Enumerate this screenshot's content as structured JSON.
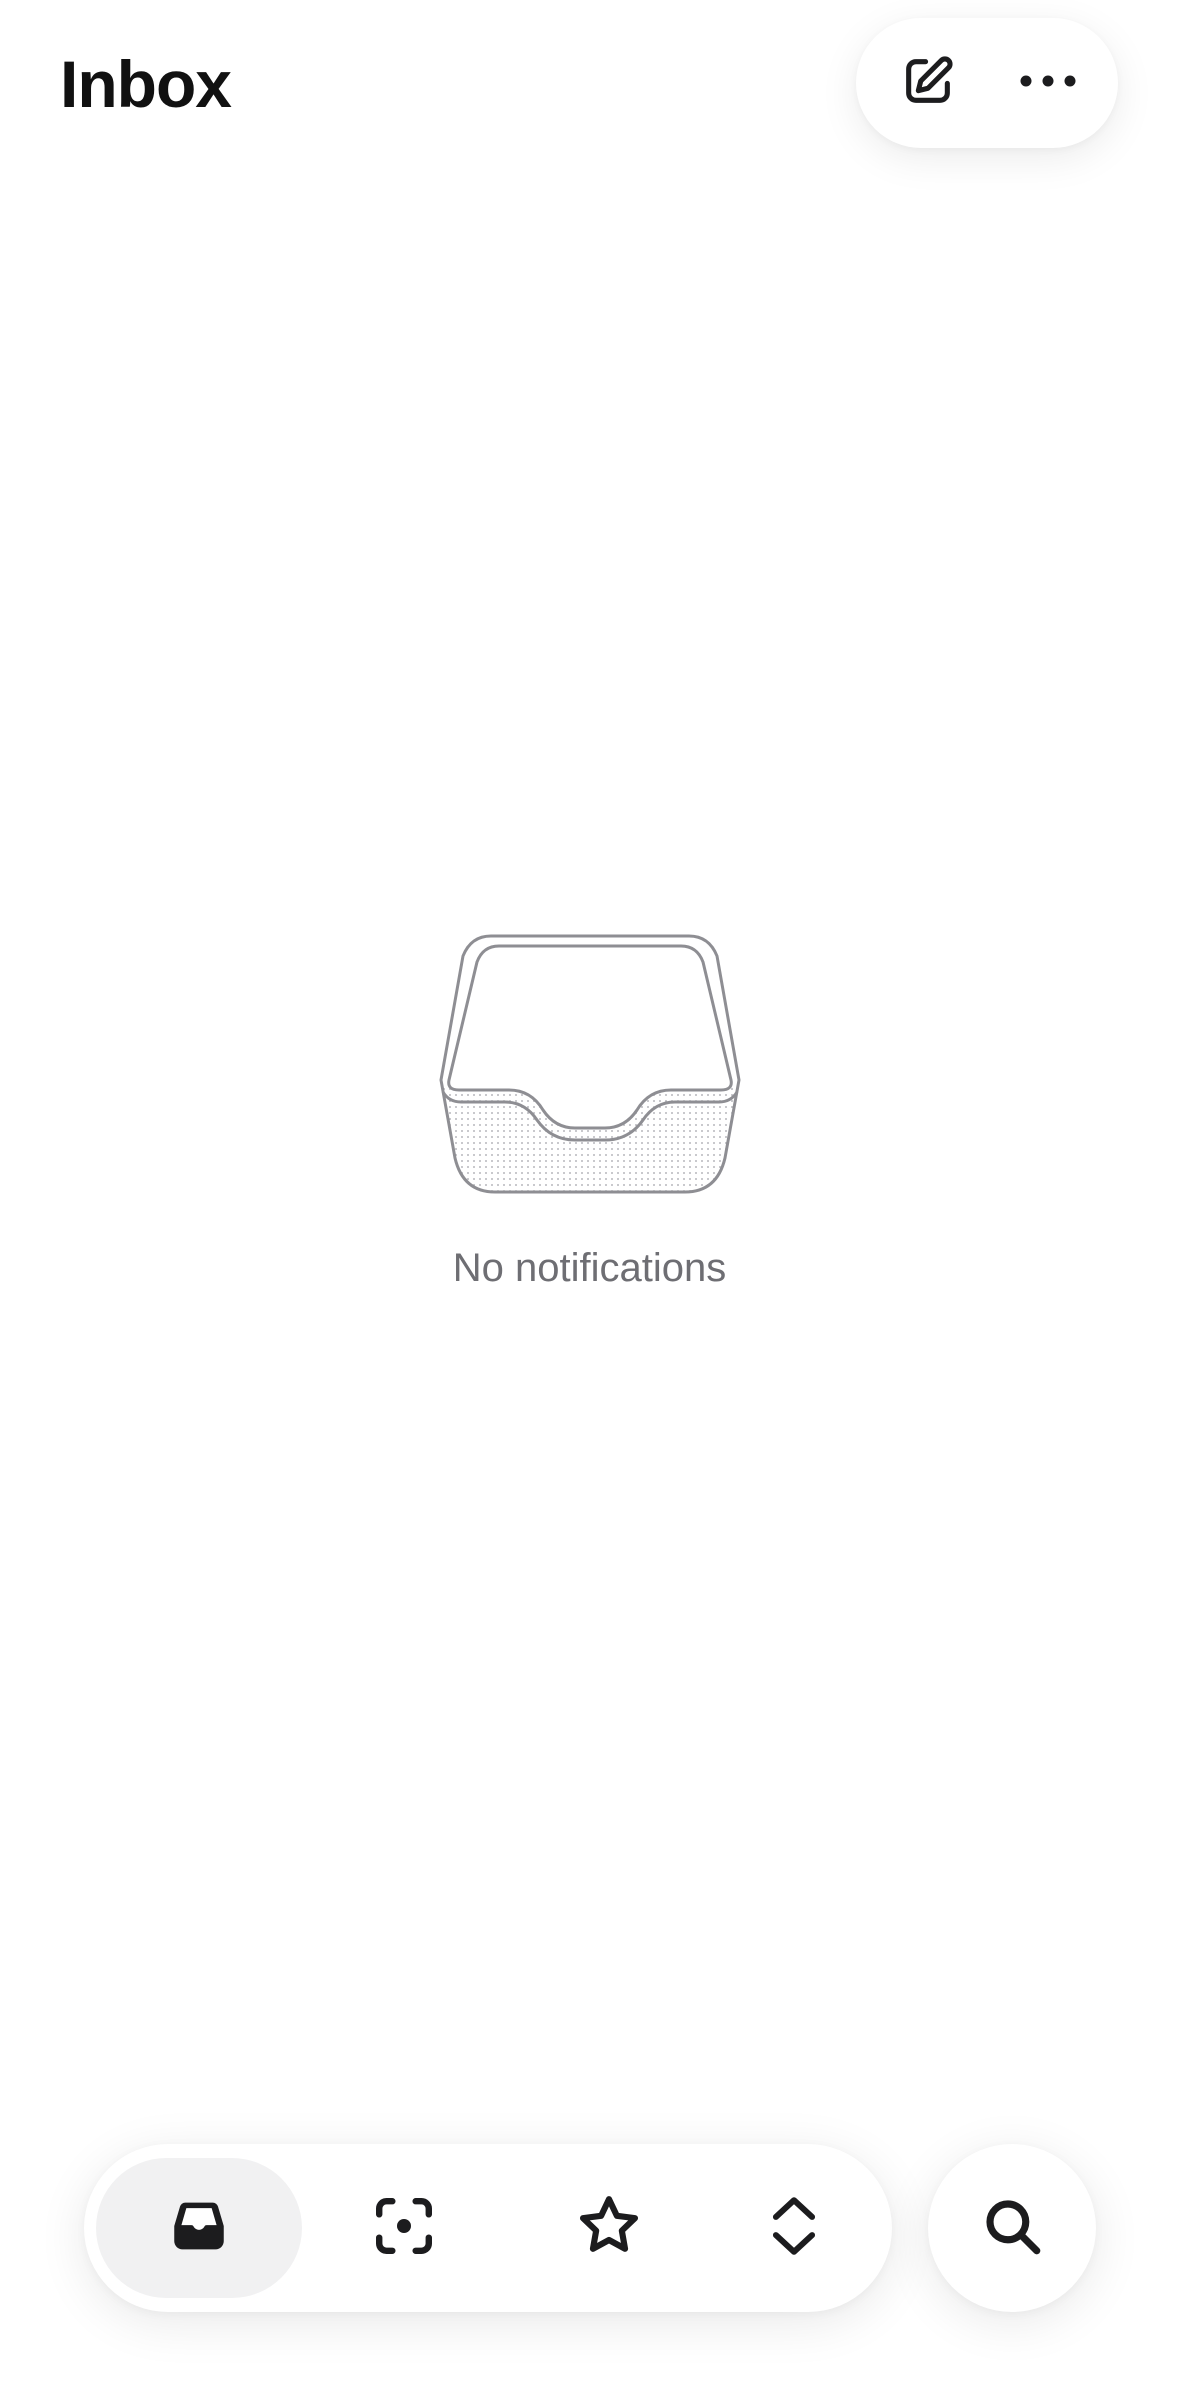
{
  "header": {
    "title": "Inbox",
    "compose_icon": "compose-icon",
    "more_icon": "more-horizontal-icon"
  },
  "empty_state": {
    "illustration": "inbox-tray-illustration",
    "message": "No notifications"
  },
  "tab_bar": {
    "tabs": [
      {
        "id": "inbox",
        "icon": "inbox-icon",
        "active": true
      },
      {
        "id": "scan",
        "icon": "scan-focus-icon",
        "active": false
      },
      {
        "id": "starred",
        "icon": "star-icon",
        "active": false
      },
      {
        "id": "switch",
        "icon": "chevron-up-down-icon",
        "active": false
      }
    ],
    "search_icon": "search-icon"
  },
  "colors": {
    "background": "#ffffff",
    "title": "#111111",
    "muted_text": "#6e6e73",
    "icon": "#1c1c1e",
    "active_tab": "#f1f1f2",
    "illustration_stroke": "#8e8e93"
  }
}
